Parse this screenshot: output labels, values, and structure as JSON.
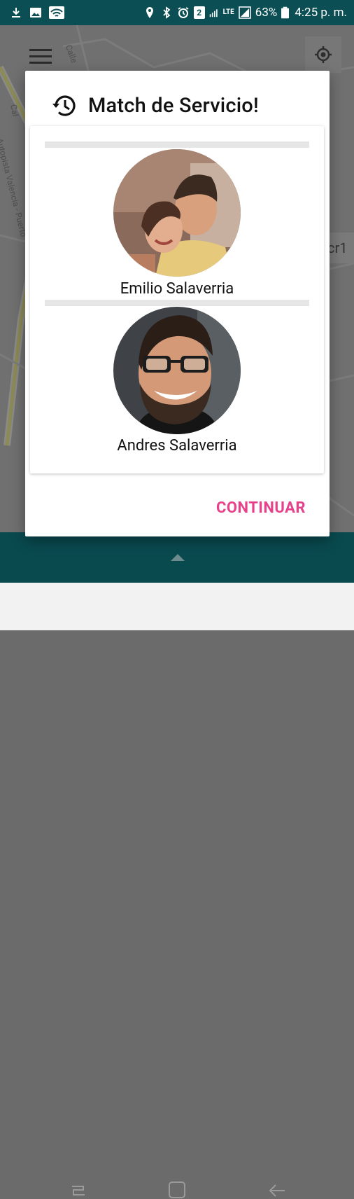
{
  "status_bar": {
    "battery": "63%",
    "time": "4:25 p. m.",
    "notification_count": "2",
    "network": "LTE",
    "icons": [
      "download-icon",
      "image-icon",
      "wifi-icon",
      "location-icon",
      "bluetooth-icon",
      "alarm-icon",
      "notification-badge",
      "signal-icon",
      "lte-icon",
      "battery-icon"
    ]
  },
  "map": {
    "labels": [
      "Calle",
      "Autopista Valencia - Puerto",
      "Cal"
    ],
    "side_chip_text": "cr1"
  },
  "dialog": {
    "title": "Match de Servicio!",
    "title_icon": "history-icon",
    "matches": [
      {
        "name": "Emilio Salaverria"
      },
      {
        "name": "Andres Salaverria"
      }
    ],
    "continue_label": "CONTINUAR",
    "accent_color": "#e6418a"
  },
  "nav_bar": {
    "buttons": [
      "recents-button",
      "home-button",
      "back-button"
    ]
  }
}
